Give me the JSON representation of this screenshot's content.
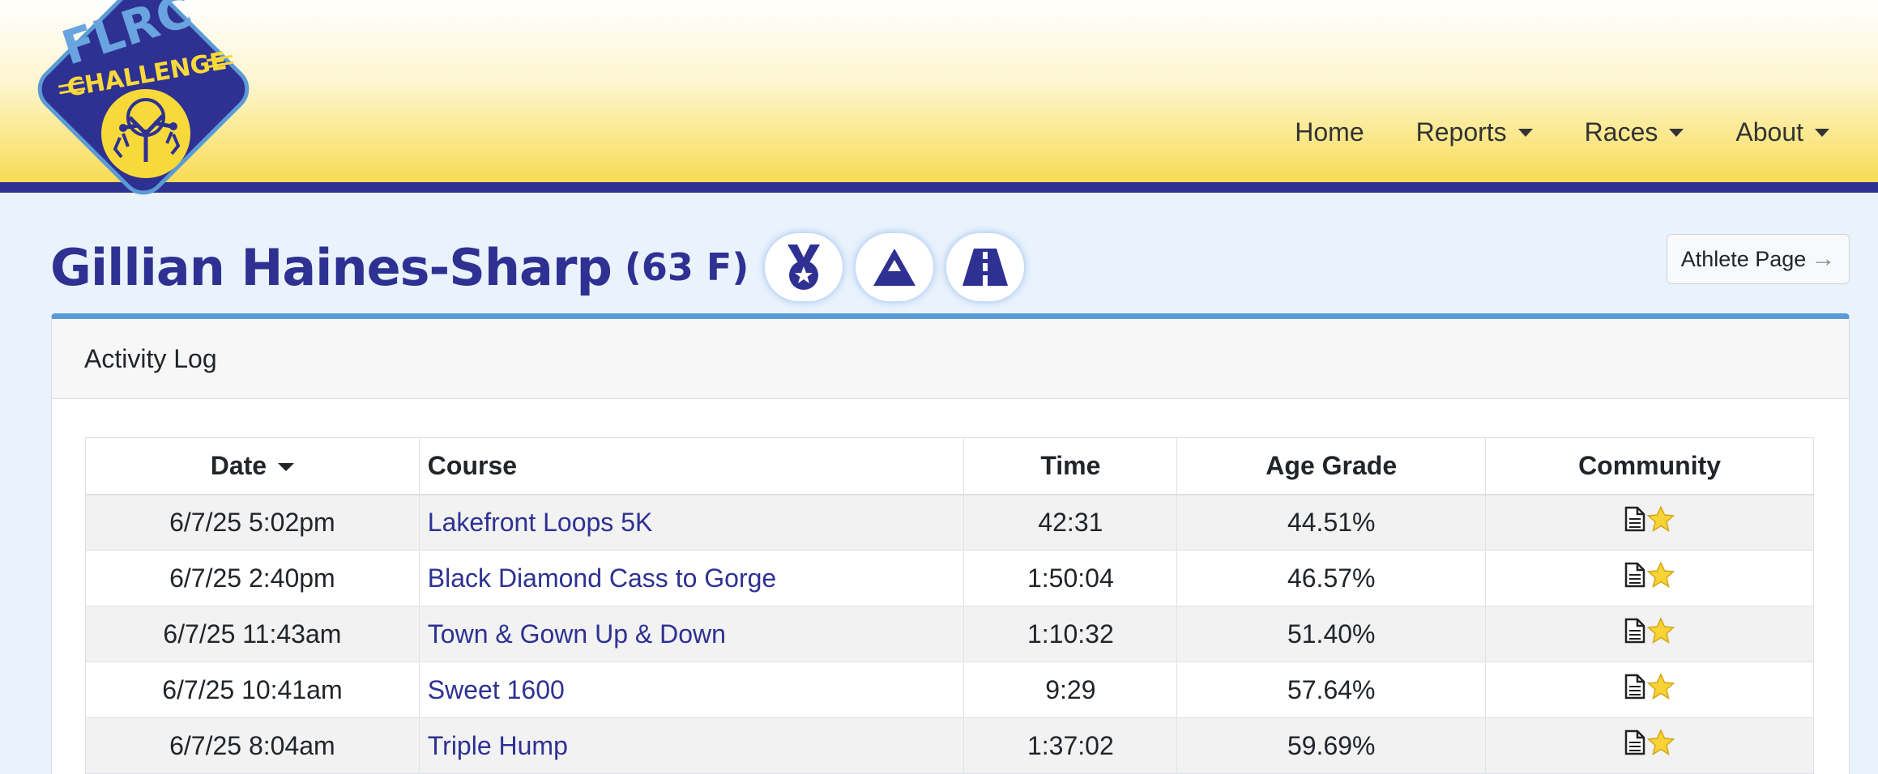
{
  "logo": {
    "top_text": "FLRC",
    "banner_text": "CHALLENGE",
    "colors": {
      "navy": "#2e3192",
      "light_blue": "#5b9bd5",
      "yellow": "#f8d93a"
    }
  },
  "nav": {
    "items": [
      {
        "label": "Home",
        "dropdown": false
      },
      {
        "label": "Reports",
        "dropdown": true
      },
      {
        "label": "Races",
        "dropdown": true
      },
      {
        "label": "About",
        "dropdown": true
      }
    ]
  },
  "athlete": {
    "name": "Gillian Haines-Sharp",
    "meta": "(63 F)",
    "badges": [
      "medal-icon",
      "mountain-icon",
      "road-icon"
    ],
    "page_button": "Athlete Page",
    "page_button_icon": "arrow-right-icon"
  },
  "activity_log": {
    "title": "Activity Log",
    "columns": {
      "date": "Date",
      "course": "Course",
      "time": "Time",
      "age_grade": "Age Grade",
      "community": "Community"
    },
    "sort_column": "date",
    "rows": [
      {
        "date": "6/7/25 5:02pm",
        "course": "Lakefront Loops 5K",
        "time": "42:31",
        "age_grade": "44.51%",
        "community": [
          "document-icon",
          "star-icon"
        ]
      },
      {
        "date": "6/7/25 2:40pm",
        "course": "Black Diamond Cass to Gorge",
        "time": "1:50:04",
        "age_grade": "46.57%",
        "community": [
          "document-icon",
          "star-icon"
        ]
      },
      {
        "date": "6/7/25 11:43am",
        "course": "Town & Gown Up & Down",
        "time": "1:10:32",
        "age_grade": "51.40%",
        "community": [
          "document-icon",
          "star-icon"
        ]
      },
      {
        "date": "6/7/25 10:41am",
        "course": "Sweet 1600",
        "time": "9:29",
        "age_grade": "57.64%",
        "community": [
          "document-icon",
          "star-icon"
        ]
      },
      {
        "date": "6/7/25 8:04am",
        "course": "Triple Hump",
        "time": "1:37:02",
        "age_grade": "59.69%",
        "community": [
          "document-icon",
          "star-icon"
        ]
      }
    ]
  },
  "colors": {
    "brand_navy": "#2e3192",
    "header_yellow": "#f8dc55",
    "card_accent": "#5b9bd5",
    "page_bg": "#eaf3fc",
    "star": "#f7d336"
  }
}
